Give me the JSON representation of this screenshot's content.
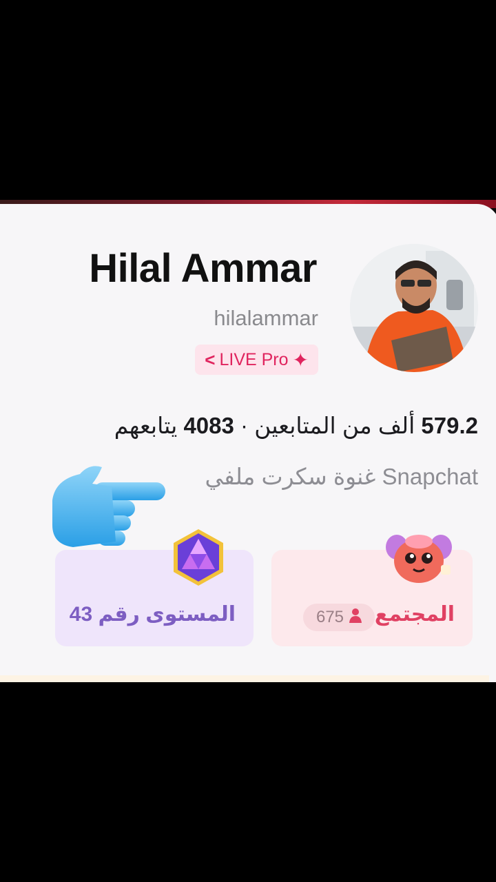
{
  "profile": {
    "name": "Hilal Ammar",
    "username": "hilalammar",
    "badge": {
      "back_chevron": "<",
      "label": "LIVE Pro",
      "spark": "✦"
    },
    "stats": {
      "followers_value": "579.2",
      "followers_label": "ألف من المتابعين",
      "separator": "·",
      "following_value": "4083",
      "following_label": "يتابعهم"
    },
    "bio": "Snapchat غنوة سكرت ملفي"
  },
  "tiles": {
    "level": {
      "label": "المستوى رقم 43",
      "icon": "crystal-gem-icon"
    },
    "community": {
      "label": "المجتمع",
      "member_count": "675",
      "icon": "strawberry-mascot-icon"
    }
  },
  "overlay": {
    "icon": "pointing-hand-icon"
  },
  "colors": {
    "badge_pink": "#e0245e",
    "level_purple": "#7d5ec2",
    "community_red": "#e04163"
  }
}
